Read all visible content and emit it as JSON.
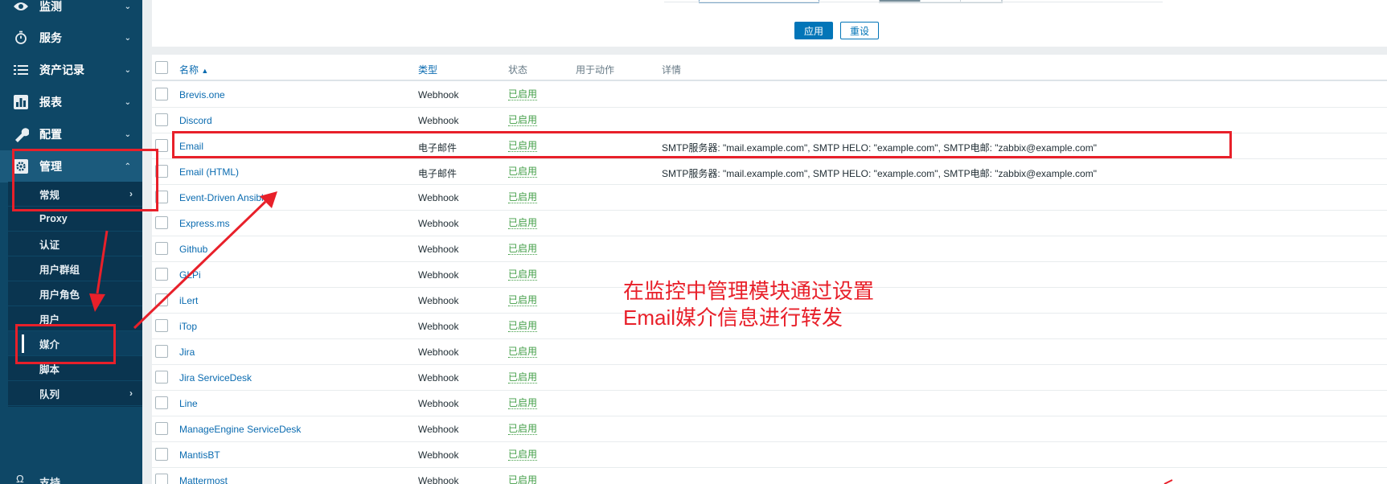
{
  "sidebar": {
    "items": [
      {
        "label": "监测",
        "icon": "eye-icon"
      },
      {
        "label": "服务",
        "icon": "timer-icon"
      },
      {
        "label": "资产记录",
        "icon": "list-icon"
      },
      {
        "label": "报表",
        "icon": "bar-chart-icon"
      },
      {
        "label": "配置",
        "icon": "wrench-icon"
      },
      {
        "label": "管理",
        "icon": "gear-icon"
      }
    ],
    "submenu": [
      {
        "label": "常规"
      },
      {
        "label": "Proxy"
      },
      {
        "label": "认证"
      },
      {
        "label": "用户群组"
      },
      {
        "label": "用户角色"
      },
      {
        "label": "用户"
      },
      {
        "label": "媒介"
      },
      {
        "label": "脚本"
      },
      {
        "label": "队列"
      }
    ],
    "support_label": "支持"
  },
  "filter": {
    "apply_label": "应用",
    "reset_label": "重设"
  },
  "table": {
    "headers": {
      "name": "名称",
      "sort_indicator": "▲",
      "type": "类型",
      "status": "状态",
      "used_in_actions": "用于动作",
      "details": "详情"
    },
    "rows": [
      {
        "name": "Brevis.one",
        "type": "Webhook",
        "status": "已启用",
        "details": ""
      },
      {
        "name": "Discord",
        "type": "Webhook",
        "status": "已启用",
        "details": ""
      },
      {
        "name": "Email",
        "type": "电子邮件",
        "status": "已启用",
        "details": "SMTP服务器: \"mail.example.com\", SMTP HELO: \"example.com\", SMTP电邮: \"zabbix@example.com\""
      },
      {
        "name": "Email (HTML)",
        "type": "电子邮件",
        "status": "已启用",
        "details": "SMTP服务器: \"mail.example.com\", SMTP HELO: \"example.com\", SMTP电邮: \"zabbix@example.com\""
      },
      {
        "name": "Event-Driven Ansible",
        "type": "Webhook",
        "status": "已启用",
        "details": ""
      },
      {
        "name": "Express.ms",
        "type": "Webhook",
        "status": "已启用",
        "details": ""
      },
      {
        "name": "Github",
        "type": "Webhook",
        "status": "已启用",
        "details": ""
      },
      {
        "name": "GLPi",
        "type": "Webhook",
        "status": "已启用",
        "details": ""
      },
      {
        "name": "iLert",
        "type": "Webhook",
        "status": "已启用",
        "details": ""
      },
      {
        "name": "iTop",
        "type": "Webhook",
        "status": "已启用",
        "details": ""
      },
      {
        "name": "Jira",
        "type": "Webhook",
        "status": "已启用",
        "details": ""
      },
      {
        "name": "Jira ServiceDesk",
        "type": "Webhook",
        "status": "已启用",
        "details": ""
      },
      {
        "name": "Line",
        "type": "Webhook",
        "status": "已启用",
        "details": ""
      },
      {
        "name": "ManageEngine ServiceDesk",
        "type": "Webhook",
        "status": "已启用",
        "details": ""
      },
      {
        "name": "MantisBT",
        "type": "Webhook",
        "status": "已启用",
        "details": ""
      },
      {
        "name": "Mattermost",
        "type": "Webhook",
        "status": "已启用",
        "details": ""
      }
    ]
  },
  "annotation": {
    "line1": "在监控中管理模块通过设置",
    "line2": "Email媒介信息进行转发",
    "color": "#e8202a"
  },
  "colors": {
    "sidebar_bg": "#0e4766",
    "link": "#0a6bb0",
    "enabled_green": "#429e47",
    "primary_button": "#0275b8"
  }
}
